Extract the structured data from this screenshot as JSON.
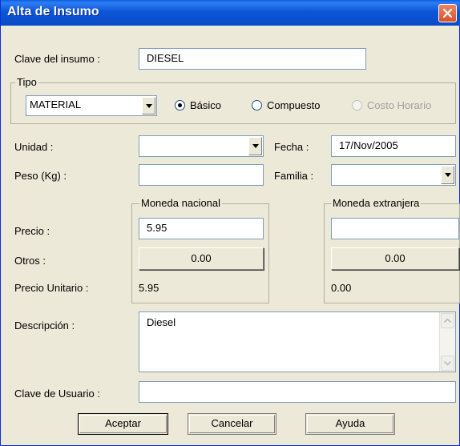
{
  "window": {
    "title": "Alta de Insumo",
    "close_icon": "close-icon",
    "accent": "#0a4cc6",
    "close_color": "#d85228"
  },
  "clave_insumo": {
    "label": "Clave del insumo :",
    "value": "DIESEL"
  },
  "tipo": {
    "group_label": "Tipo",
    "selected": "MATERIAL",
    "options": [
      {
        "label": "Básico",
        "checked": true,
        "enabled": true
      },
      {
        "label": "Compuesto",
        "checked": false,
        "enabled": true
      },
      {
        "label": "Costo Horario",
        "checked": false,
        "enabled": false
      }
    ]
  },
  "unidad": {
    "label": "Unidad :",
    "value": ""
  },
  "fecha": {
    "label": "Fecha :",
    "value": "17/Nov/2005"
  },
  "peso": {
    "label": "Peso (Kg) :",
    "value": ""
  },
  "familia": {
    "label": "Familia :",
    "value": ""
  },
  "moneda_nacional": {
    "group_label": "Moneda nacional",
    "precio": "5.95",
    "otros": "0.00",
    "precio_unitario": "5.95"
  },
  "moneda_extranjera": {
    "group_label": "Moneda extranjera",
    "precio": "",
    "otros": "0.00",
    "precio_unitario": "0.00"
  },
  "row_labels": {
    "precio": "Precio :",
    "otros": "Otros :",
    "precio_unitario": "Precio Unitario :"
  },
  "descripcion": {
    "label": "Descripción :",
    "value": "Diesel"
  },
  "clave_usuario": {
    "label": "Clave de Usuario :",
    "value": ""
  },
  "buttons": {
    "aceptar": "Aceptar",
    "cancelar": "Cancelar",
    "ayuda": "Ayuda"
  }
}
